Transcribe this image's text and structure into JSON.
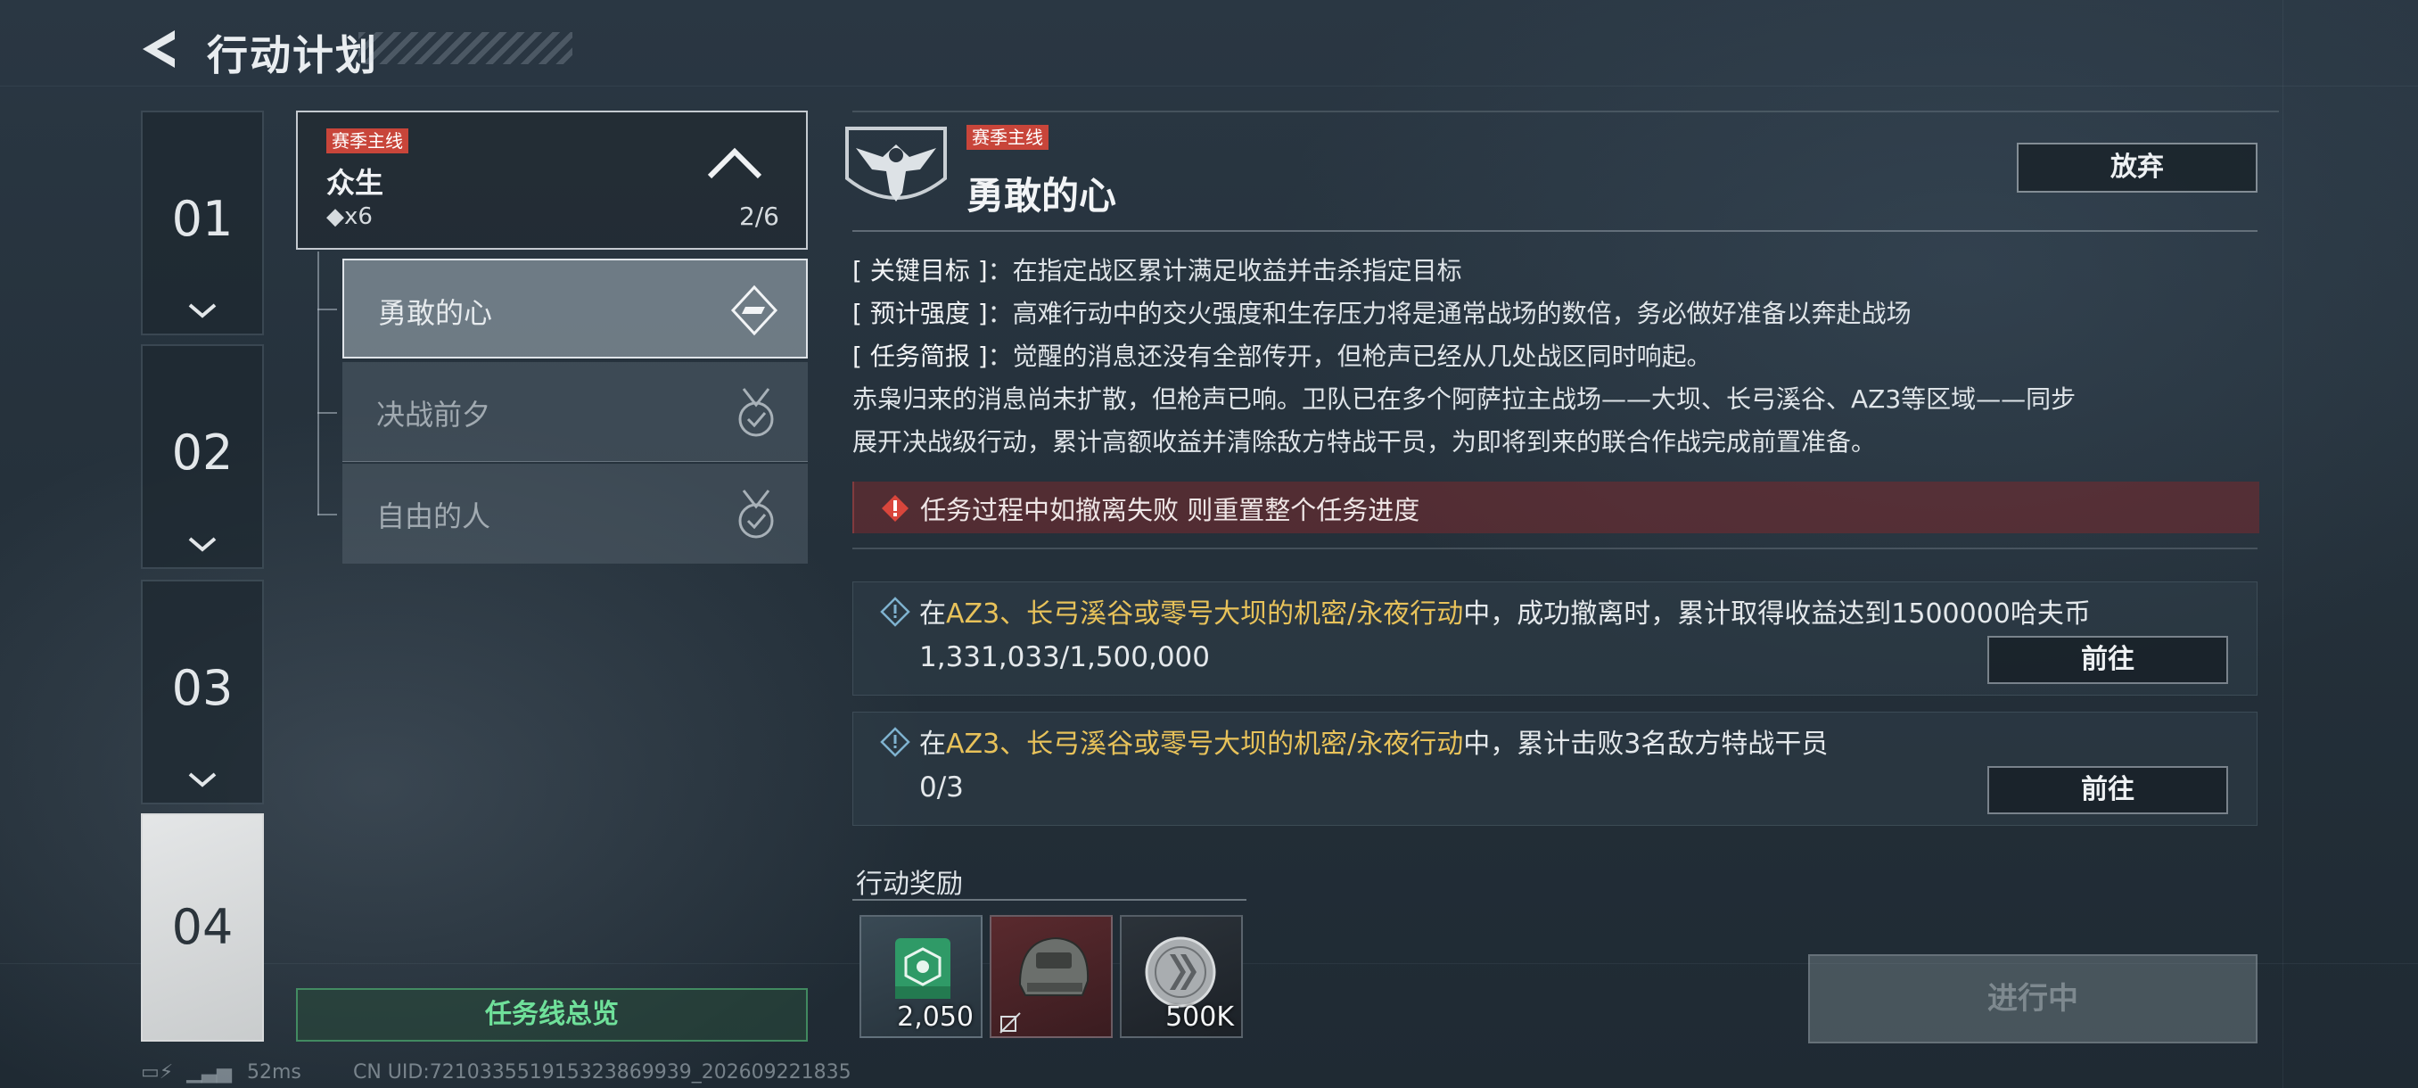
{
  "header": {
    "title": "行动计划"
  },
  "chapters": [
    {
      "num": "01"
    },
    {
      "num": "02"
    },
    {
      "num": "03"
    },
    {
      "num": "04"
    }
  ],
  "mission": {
    "tag": "赛季主线",
    "name": "众生",
    "cost": "◆x6",
    "progress": "2/6",
    "subs": [
      {
        "label": "勇敢的心"
      },
      {
        "label": "决战前夕"
      },
      {
        "label": "自由的人"
      }
    ],
    "overview_label": "任务线总览"
  },
  "detail": {
    "tag": "赛季主线",
    "title": "勇敢的心",
    "abandon_label": "放弃",
    "lines": [
      {
        "key": "[ 关键目标 ]",
        "text": "在指定战区累计满足收益并击杀指定目标"
      },
      {
        "key": "[ 预计强度 ]",
        "text": "高难行动中的交火强度和生存压力将是通常战场的数倍，务必做好准备以奔赴战场"
      },
      {
        "key": "[ 任务简报 ]",
        "text": "觉醒的消息还没有全部传开，但枪声已经从几处战区同时响起。"
      }
    ],
    "story1": "赤枭归来的消息尚未扩散，但枪声已响。卫队已在多个阿萨拉主战场——大坝、长弓溪谷、AZ3等区域——同步",
    "story2": "展开决战级行动，累计高额收益并清除敌方特战干员，为即将到来的联合作战完成前置准备。",
    "warning": "任务过程中如撤离失败 则重置整个任务进度",
    "tasks": [
      {
        "pre": "在",
        "highlight": "AZ3、长弓溪谷或零号大坝的机密/永夜行动",
        "post": "中，成功撤离时，累计取得收益达到1500000哈夫币",
        "progress": "1,331,033/1,500,000",
        "go_label": "前往"
      },
      {
        "pre": "在",
        "highlight": "AZ3、长弓溪谷或零号大坝的机密/永夜行动",
        "post": "中，累计击败3名敌方特战干员",
        "progress": "0/3",
        "go_label": "前往"
      }
    ],
    "reward_label": "行动奖励",
    "rewards": [
      {
        "icon": "green-crate-icon",
        "qty": "2,050"
      },
      {
        "icon": "tactical-helmet-icon",
        "qty": ""
      },
      {
        "icon": "silver-coin-icon",
        "qty": "500K"
      }
    ],
    "status_label": "进行中"
  },
  "status": {
    "ping": "52ms",
    "uid": "CN UID:721033551915323869939_202609221835"
  },
  "colors": {
    "tag_red": "#c8453a",
    "highlight": "#e8c25a",
    "overview_green": "#6fe09a"
  }
}
